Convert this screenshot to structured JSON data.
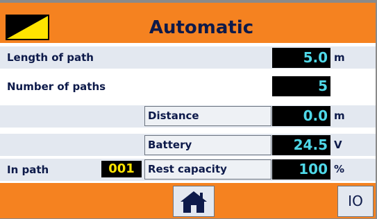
{
  "header": {
    "title": "Automatic",
    "mode_icon": "ramp-icon",
    "color": "#f58220"
  },
  "rows": {
    "length_of_path": {
      "label": "Length of path",
      "value": "5.0",
      "unit": "m"
    },
    "number_of_paths": {
      "label": "Number of paths",
      "value": "5"
    },
    "distance": {
      "label": "Distance",
      "value": "0.0",
      "unit": "m"
    },
    "battery": {
      "label": "Battery",
      "value": "24.5",
      "unit": "V"
    },
    "in_path": {
      "label": "In path",
      "value": "001"
    },
    "rest_capacity": {
      "label": "Rest capacity",
      "value": "100",
      "unit": "%"
    }
  },
  "footer": {
    "home_icon": "home-icon",
    "io_label": "IO"
  },
  "colors": {
    "accent": "#f58220",
    "value_text": "#4fd8e8",
    "in_path_text": "#ffe400",
    "label_text": "#0d1a4a"
  }
}
